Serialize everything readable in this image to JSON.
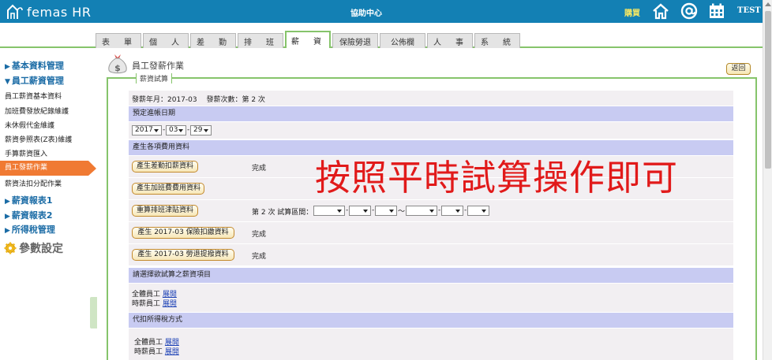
{
  "header": {
    "logo_text": "femas HR",
    "center_title": "協助中心",
    "buy_label": "購買",
    "user": "TEST",
    "icons": [
      "home-icon",
      "at-icon",
      "calendar-icon"
    ]
  },
  "tabs": [
    "表　單",
    "個　人",
    "差　勤",
    "排　班",
    "薪　資",
    "保險勞退",
    "公佈欄",
    "人　事",
    "系　統"
  ],
  "active_tab": "薪　資",
  "sidebar": {
    "group1": "基本資料管理",
    "group2": "員工薪資管理",
    "items": [
      "員工薪資基本資料",
      "加班費發放紀錄維護",
      "未休假代金維護",
      "薪資參照表(Z表)維護",
      "手算薪資匯入",
      "員工發薪作業",
      "薪資法扣分配作業"
    ],
    "active_item": "員工發薪作業",
    "group3": "薪資報表1",
    "group4": "薪資報表2",
    "group5": "所得稅管理",
    "settings": "參數設定"
  },
  "main": {
    "page_title": "員工發薪作業",
    "back_button": "返回",
    "legend": "薪資試算",
    "pay_info": "發薪年月：2017-03　 發薪次數：第 2 次",
    "section_date": "預定進帳日期",
    "date_year": "2017",
    "date_month": "03",
    "date_day": "29",
    "section_produce": "產生各項費用資料",
    "btn_leave": "產生差勤扣薪資料",
    "btn_overtime": "產生加班費費用資料",
    "btn_shift": "重算排班津貼資料",
    "btn_insurance": "產生 2017-03 保險扣繳資料",
    "btn_pension": "產生 2017-03 勞退提撥資料",
    "status_done": "完成",
    "shift_period_label": "第 2 次 試算區間：",
    "tilde": "～",
    "section_items": "請選擇欲試算之薪資項目",
    "all_employees": "全體員工",
    "hourly_employees": "時薪員工",
    "expand_link": "展開",
    "section_tax": "代扣所得稅方式",
    "overlay_text": "按照平時試算操作即可"
  }
}
